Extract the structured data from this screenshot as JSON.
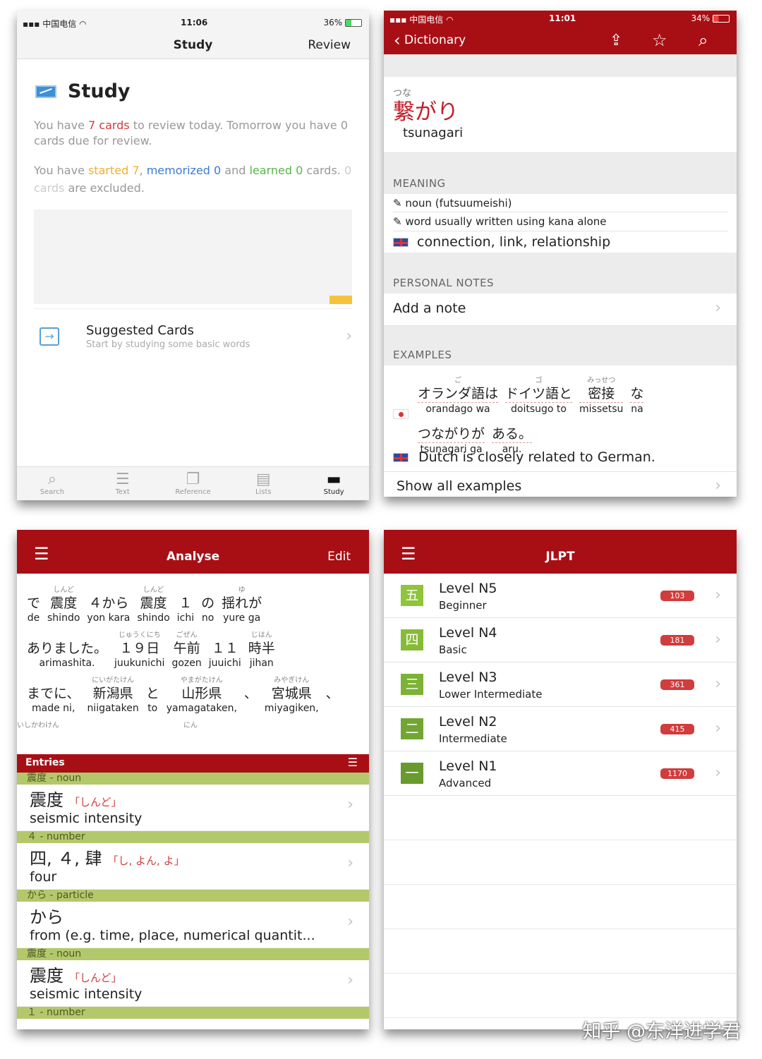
{
  "study": {
    "status": {
      "carrier": "中国电信",
      "time": "11:06",
      "battery": "36%"
    },
    "nav": {
      "title": "Study",
      "review": "Review"
    },
    "heading": "Study",
    "p1": {
      "a": "You have ",
      "b": "7 cards",
      "c": " to review today. Tomorrow you have 0 cards due for review."
    },
    "p2": {
      "a": "You have ",
      "started": "started 7",
      "b": ", ",
      "memorized": "memorized 0",
      "c": " and ",
      "learned": "learned 0",
      "d": " cards. ",
      "excl": "0 cards",
      "e": " are excluded."
    },
    "suggested": {
      "title": "Suggested Cards",
      "sub": "Start by studying some basic words"
    },
    "tabs": [
      {
        "label": "Search",
        "icon": "search-icon"
      },
      {
        "label": "Text",
        "icon": "text-icon"
      },
      {
        "label": "Reference",
        "icon": "reference-icon"
      },
      {
        "label": "Lists",
        "icon": "lists-icon"
      },
      {
        "label": "Study",
        "icon": "study-icon"
      }
    ]
  },
  "dict": {
    "status": {
      "carrier": "中国电信",
      "time": "11:01",
      "battery": "34%"
    },
    "nav": {
      "back": "Dictionary"
    },
    "word": {
      "reading": "つな",
      "kanji": "繋がり",
      "romaji": "tsunagari"
    },
    "meaning": {
      "header": "MEANING",
      "pos1": "noun (futsuumeishi)",
      "pos2": "word usually written using kana alone",
      "def": "connection, link, relationship"
    },
    "notes": {
      "header": "PERSONAL NOTES",
      "add": "Add a note"
    },
    "examples": {
      "header": "EXAMPLES",
      "line1": [
        {
          "rb": "ご",
          "w": "オランダ語は",
          "r": "orandago wa"
        },
        {
          "rb": "ゴ",
          "w": "ドイツ語と",
          "r": "doitsugo to"
        },
        {
          "rb": "みっせつ",
          "w": "密接",
          "r": "missetsu"
        },
        {
          "rb": "",
          "w": "な",
          "r": "na"
        }
      ],
      "line2": [
        {
          "rb": "",
          "w": "つながりが",
          "r": "tsunagari ga"
        },
        {
          "rb": "",
          "w": "ある。",
          "r": "aru."
        }
      ],
      "translation": "Dutch is closely related to German.",
      "show_all": "Show all examples"
    }
  },
  "analyse": {
    "nav": {
      "title": "Analyse",
      "edit": "Edit"
    },
    "lines": [
      [
        {
          "rb": "",
          "w": "で",
          "r": "de"
        },
        {
          "rb": "しんど",
          "w": "震度",
          "r": "shindo"
        },
        {
          "rb": "",
          "w": "４から",
          "r": "yon kara"
        },
        {
          "rb": "しんど",
          "w": "震度",
          "r": "shindo"
        },
        {
          "rb": "",
          "w": "１",
          "r": "ichi"
        },
        {
          "rb": "",
          "w": "の",
          "r": "no"
        },
        {
          "rb": "ゆ",
          "w": "揺れが",
          "r": "yure ga"
        }
      ],
      [
        {
          "rb": "",
          "w": "ありました。",
          "r": "arimashita."
        },
        {
          "rb": "じゅうくにち",
          "w": "１９日",
          "r": "juukunichi"
        },
        {
          "rb": "ごぜん",
          "w": "午前",
          "r": "gozen"
        },
        {
          "rb": "",
          "w": "１１",
          "r": "juuichi"
        },
        {
          "rb": "じはん",
          "w": "時半",
          "r": "jihan"
        }
      ],
      [
        {
          "rb": "",
          "w": "までに、",
          "r": "made ni,"
        },
        {
          "rb": "にいがたけん",
          "w": "新潟県",
          "r": "niigataken"
        },
        {
          "rb": "",
          "w": "と",
          "r": "to"
        },
        {
          "rb": "やまがたけん",
          "w": "山形県",
          "r": "yamagataken,"
        },
        {
          "rb": "",
          "w": "、",
          "r": ""
        },
        {
          "rb": "みやぎけん",
          "w": "宮城県",
          "r": "miyagiken,"
        },
        {
          "rb": "",
          "w": "、",
          "r": ""
        }
      ]
    ],
    "partial": {
      "a": "いしかわけん",
      "b": "にん"
    },
    "entries_label": "Entries",
    "entries": [
      {
        "group": "震度 - noun",
        "kanji": "震度",
        "reading": "「しんど」",
        "meaning": "seismic intensity"
      },
      {
        "group": "４ - number",
        "kanji": "四, ４, 肆",
        "reading": "「し, よん, よ」",
        "meaning": "four"
      },
      {
        "group": "から - particle",
        "kanji": "から",
        "reading": "",
        "meaning": "from (e.g. time, place, numerical quantit..."
      },
      {
        "group": "震度 - noun",
        "kanji": "震度",
        "reading": "「しんど」",
        "meaning": "seismic intensity"
      }
    ],
    "last_group": "１ - number"
  },
  "jlpt": {
    "nav": {
      "title": "JLPT"
    },
    "levels": [
      {
        "kanji": "五",
        "title": "Level N5",
        "sub": "Beginner",
        "count": "103",
        "color": "#8fc43c"
      },
      {
        "kanji": "四",
        "title": "Level N4",
        "sub": "Basic",
        "count": "181",
        "color": "#86bb38"
      },
      {
        "kanji": "三",
        "title": "Level N3",
        "sub": "Lower Intermediate",
        "count": "361",
        "color": "#7cb236"
      },
      {
        "kanji": "二",
        "title": "Level N2",
        "sub": "Intermediate",
        "count": "415",
        "color": "#72a632"
      },
      {
        "kanji": "一",
        "title": "Level N1",
        "sub": "Advanced",
        "count": "1170",
        "color": "#689a2e"
      }
    ]
  },
  "watermark": "知乎 @东洋进学君"
}
